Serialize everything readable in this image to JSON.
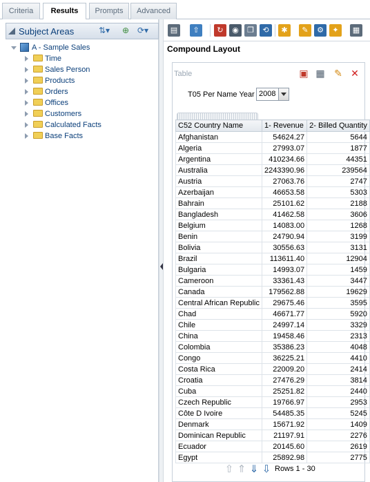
{
  "tabs": [
    {
      "label": "Criteria"
    },
    {
      "label": "Results"
    },
    {
      "label": "Prompts"
    },
    {
      "label": "Advanced"
    }
  ],
  "left_pane": {
    "title": "Subject Areas",
    "root": "A - Sample Sales",
    "folders": [
      "Time",
      "Sales Person",
      "Products",
      "Orders",
      "Offices",
      "Customers",
      "Calculated Facts",
      "Base Facts"
    ]
  },
  "right_pane": {
    "section_title": "Compound Layout",
    "view": {
      "title": "Table",
      "prompt_label": "T05 Per Name Year",
      "prompt_value": "2008",
      "columns": [
        "C52 Country Name",
        "1- Revenue",
        "2- Billed Quantity"
      ],
      "rows": [
        [
          "Afghanistan",
          "54624.27",
          "5644"
        ],
        [
          "Algeria",
          "27993.07",
          "1877"
        ],
        [
          "Argentina",
          "410234.66",
          "44351"
        ],
        [
          "Australia",
          "2243390.96",
          "239564"
        ],
        [
          "Austria",
          "27063.76",
          "2747"
        ],
        [
          "Azerbaijan",
          "46653.58",
          "5303"
        ],
        [
          "Bahrain",
          "25101.62",
          "2188"
        ],
        [
          "Bangladesh",
          "41462.58",
          "3606"
        ],
        [
          "Belgium",
          "14083.00",
          "1268"
        ],
        [
          "Benin",
          "24790.94",
          "3199"
        ],
        [
          "Bolivia",
          "30556.63",
          "3131"
        ],
        [
          "Brazil",
          "113611.40",
          "12904"
        ],
        [
          "Bulgaria",
          "14993.07",
          "1459"
        ],
        [
          "Cameroon",
          "33361.43",
          "3447"
        ],
        [
          "Canada",
          "179562.88",
          "19629"
        ],
        [
          "Central African Republic",
          "29675.46",
          "3595"
        ],
        [
          "Chad",
          "46671.77",
          "5920"
        ],
        [
          "Chile",
          "24997.14",
          "3329"
        ],
        [
          "China",
          "19458.46",
          "2313"
        ],
        [
          "Colombia",
          "35386.23",
          "4048"
        ],
        [
          "Congo",
          "36225.21",
          "4410"
        ],
        [
          "Costa Rica",
          "22009.20",
          "2414"
        ],
        [
          "Croatia",
          "27476.29",
          "3814"
        ],
        [
          "Cuba",
          "25251.82",
          "2440"
        ],
        [
          "Czech Republic",
          "19766.97",
          "2953"
        ],
        [
          "Côte D Ivoire",
          "54485.35",
          "5245"
        ],
        [
          "Denmark",
          "15671.92",
          "1409"
        ],
        [
          "Dominican Republic",
          "21197.91",
          "2276"
        ],
        [
          "Ecuador",
          "20145.60",
          "2619"
        ],
        [
          "Egypt",
          "25892.98",
          "2775"
        ]
      ],
      "pager_text": "Rows 1 - 30"
    }
  },
  "icons": {
    "toolbar": [
      "print-icon",
      "export-icon",
      "refresh-icon",
      "preview-icon",
      "copy-icon",
      "sync-icon",
      "new-view-icon",
      "edit-icon",
      "properties-icon",
      "settings-icon",
      "table-icon"
    ],
    "view": [
      "format-icon",
      "table-icon",
      "edit-pencil-icon",
      "delete-icon"
    ],
    "pager": [
      "first-page-icon",
      "prev-page-icon",
      "next-page-icon",
      "last-page-icon"
    ]
  }
}
